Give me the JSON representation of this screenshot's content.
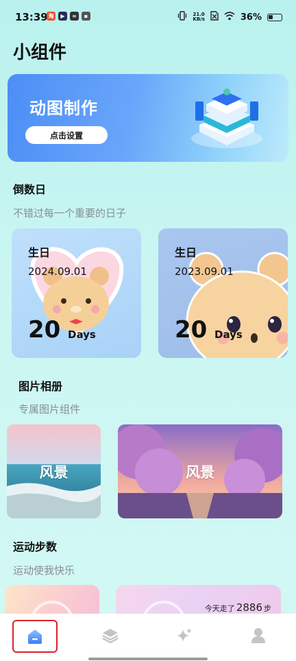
{
  "status_bar": {
    "time": "13:39",
    "net_speed_value": "21.0",
    "net_speed_unit": "KB/s",
    "battery": "36%"
  },
  "page": {
    "title": "小组件"
  },
  "banner": {
    "title": "动图制作",
    "button_label": "点击设置"
  },
  "countdown": {
    "title": "倒数日",
    "subtitle": "不错过每一个重要的日子",
    "cards": [
      {
        "label": "生日",
        "date": "2024.09.01",
        "days": "20",
        "unit": "Days"
      },
      {
        "label": "生日",
        "date": "2023.09.01",
        "days": "20",
        "unit": "Days"
      }
    ]
  },
  "album": {
    "title": "图片相册",
    "subtitle": "专属图片组件",
    "cards": [
      {
        "label": "风景"
      },
      {
        "label": "风景"
      }
    ]
  },
  "steps": {
    "title": "运动步数",
    "subtitle": "运动使我快乐",
    "today_prefix": "今天走了",
    "today_count": "2886",
    "today_suffix": "步"
  },
  "tabs": [
    {
      "icon": "home-icon",
      "selected": true
    },
    {
      "icon": "layers-icon",
      "selected": false
    },
    {
      "icon": "sparkle-icon",
      "selected": false
    },
    {
      "icon": "user-icon",
      "selected": false
    }
  ],
  "colors": {
    "accent": "#4f8ff5",
    "selection_outline": "#d6242b",
    "background": "#c9f6f2"
  }
}
